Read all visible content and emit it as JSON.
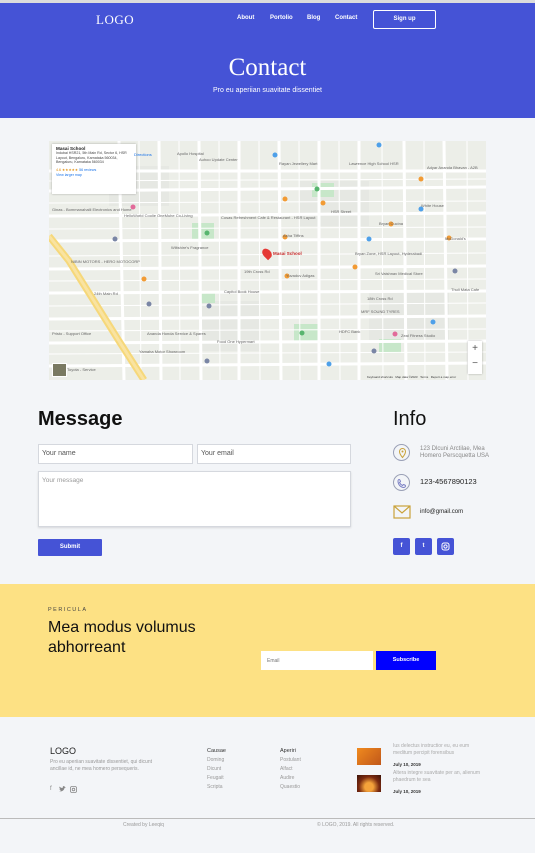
{
  "nav": {
    "logo": "LOGO",
    "links": [
      "About",
      "Portolio",
      "Blog",
      "Contact"
    ],
    "signup": "Sign up"
  },
  "hero": {
    "title": "Contact",
    "subtitle": "Pro eu aperiian suavitate dissentiet"
  },
  "map": {
    "place_name": "Masai School",
    "address": "Indubai HSR21, 5th Main Rd, Sector 6, HSR Layout, Bengaluru, Karnataka 560034, Bengaluru, Karnataka 560034",
    "rating": "4.6 ★★★★★",
    "reviews": "56 reviews",
    "view_larger": "View larger map",
    "directions": "Directions",
    "pin_label": "Masai School",
    "labels": [
      "Apollo Hospital",
      "Auhoo Update Center",
      "Rayan Jewellery Mart",
      "Lawrence High School HSR",
      "Adyar Ananda Bhavan - A2B",
      "Sanjana Yatra",
      "Oasis",
      "White House",
      "Ginas - Bommanahalli Electronics and Home",
      "HelloWorld Coolie OneMuhe Co-Living",
      "Cafe Coffee Day",
      "Cosas Refreshment Cafe & Restaurant - HSR Layout",
      "HSR Street",
      "Bryan Cucina",
      "McDonald's",
      "Asha Tiffins",
      "Wiltshire's Fragrance",
      "Masai School",
      "Yuvaduv Adigas",
      "Bryan Zone, HSR Layout, Hyderabadi",
      "Sri Vaishnav Medical Store",
      "Anand Honda",
      "Capitol Book House",
      "Food One Hypermart",
      "Myra Hotel",
      "Ananda Honda Service & Spares",
      "Yamaha Motor Showroom",
      "MRF SOUND TYRES",
      "Zeal Fitness Studio",
      "HDFC Bank",
      "Toyota - Service",
      "Rosario Chuteria",
      "Thuli Mata Cafe",
      "NIBIN MOTORS - HERO MOTOCORP",
      "Pristo - Support Office",
      "27th Main Rd",
      "24th Main Rd",
      "16th Main Rd",
      "19th Cross Rd",
      "14th Main Rd",
      "18th Cross Rd",
      "23rd Cross Rd"
    ],
    "footer_items": [
      "Keyboard shortcuts",
      "Map data ©2023",
      "Terms",
      "Report a map error"
    ]
  },
  "message": {
    "heading": "Message",
    "name_placeholder": "Your name",
    "email_placeholder": "Your email",
    "message_placeholder": "Your message",
    "submit": "Submit"
  },
  "info": {
    "heading": "Info",
    "address": "123 Dlcuni Arctilae, Mea Homero Perscquetta USA",
    "phone": "123-4567890123",
    "email": "info@gmail.com",
    "social": [
      "f",
      "t",
      "ig"
    ]
  },
  "newsletter": {
    "kicker": "PERICULA",
    "title": "Mea modus volumus abhorreant",
    "email_placeholder": "Email",
    "subscribe": "Subscribe"
  },
  "footer": {
    "logo": "LOGO",
    "description": "Pro eu aperiian suavitate dissentiet, qui dicunt ancillae id, ne mea homero persequeris.",
    "col1": {
      "title": "Causae",
      "links": [
        "Doming",
        "Dicunt",
        "Feugait",
        "Scripta"
      ]
    },
    "col2": {
      "title": "Aperiri",
      "links": [
        "Postulant",
        "Alfact",
        "Audire",
        "Quaestio"
      ]
    },
    "posts": [
      {
        "text": "Ius delectus instructior eu, eu eum meditum percipit forensibus",
        "date": "July 10, 2019"
      },
      {
        "text": "Altera integre suavitate per an, alienum phaedrum te sea",
        "date": "July 10, 2019"
      }
    ],
    "credit": "Created by Leeqiq",
    "copyright": "© LOGO, 2019. All rights reserved."
  },
  "colors": {
    "primary": "#4553d6",
    "yellow": "#fde184",
    "subscribe": "#0000ff"
  }
}
